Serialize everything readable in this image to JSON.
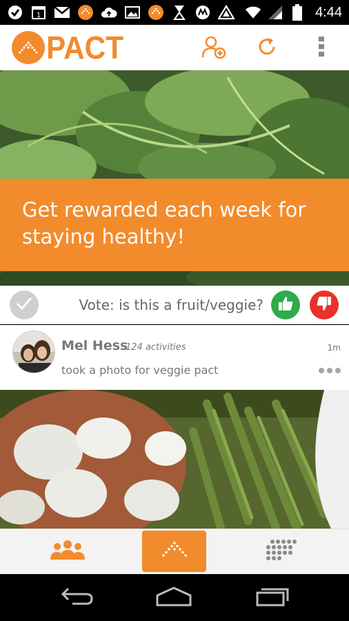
{
  "status_bar": {
    "time": "4:44",
    "icons": [
      "pushbullet-icon",
      "calendar-icon",
      "gmail-icon",
      "pact-notification-icon",
      "cloud-upload-icon",
      "image-icon",
      "pact-notification-icon",
      "bug-icon",
      "motorola-icon",
      "triangle-app-icon",
      "wifi-icon",
      "signal-icon",
      "battery-icon"
    ],
    "calendar_day": "1"
  },
  "header": {
    "logo_text": "PACT",
    "actions": [
      "add-friend-icon",
      "refresh-icon",
      "overflow-menu-icon"
    ]
  },
  "hero": {
    "banner_text": "Get rewarded each week for staying healthy!"
  },
  "vote": {
    "label": "Vote: is this a fruit/veggie?"
  },
  "post": {
    "name": "Mel Hess",
    "activity_count": "124 activities",
    "time": "1m",
    "description": "took a photo for veggie pact"
  },
  "bottom_nav": {
    "items": [
      "friends-icon",
      "pact-home-icon",
      "grid-icon"
    ],
    "active": 1
  },
  "system_nav": {
    "items": [
      "back-icon",
      "home-icon",
      "recents-icon"
    ]
  },
  "colors": {
    "brand_orange": "#f28b2c",
    "vote_up_green": "#2eab4a",
    "vote_down_red": "#e8322b"
  }
}
